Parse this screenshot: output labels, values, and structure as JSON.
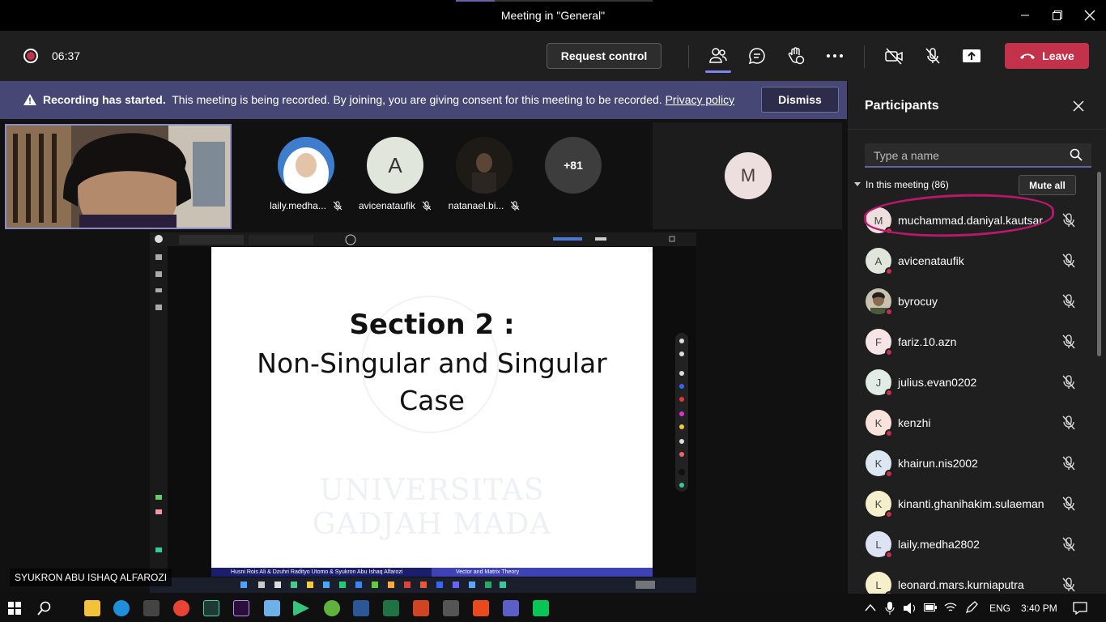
{
  "window": {
    "title": "Meeting in \"General\""
  },
  "toolbar": {
    "timer": "06:37",
    "request_control_label": "Request control",
    "leave_label": "Leave"
  },
  "banner": {
    "bold_text": "Recording has started.",
    "text": "This meeting is being recorded. By joining, you are giving consent for this meeting to be recorded.",
    "link_text": "Privacy policy",
    "dismiss_label": "Dismiss"
  },
  "stage": {
    "tiles": [
      {
        "name": "laily.medha...",
        "initial": ""
      },
      {
        "name": "avicenataufik",
        "initial": "A"
      },
      {
        "name": "natanael.bi...",
        "initial": ""
      }
    ],
    "overflow_count": "+81",
    "presenter_initial": "M",
    "presenter_label": "SYUKRON ABU ISHAQ ALFAROZI"
  },
  "slide": {
    "title": "Section 2 :",
    "subtitle_line1": "Non-Singular and Singular",
    "subtitle_line2": "Case",
    "watermark_line1": "UNIVERSITAS",
    "watermark_line2": "GADJAH MADA",
    "footer_left": "Husni Rois Ali & Dzuhri Radityo Utomo & Syukron Abu Ishaq Alfarozi",
    "footer_right": "Vector and Matrix Theory"
  },
  "panel": {
    "title": "Participants",
    "search_placeholder": "Type a name",
    "section_label": "In this meeting (86)",
    "mute_all_label": "Mute all",
    "participants": [
      {
        "name": "muchammad.daniyal.kautsar",
        "initial": "M",
        "color": "#eedfdf"
      },
      {
        "name": "avicenataufik",
        "initial": "A",
        "color": "#e0e6dc"
      },
      {
        "name": "byrocuy",
        "initial": "",
        "color": "#6b7a6a"
      },
      {
        "name": "fariz.10.azn",
        "initial": "F",
        "color": "#f6e4e6"
      },
      {
        "name": "julius.evan0202",
        "initial": "J",
        "color": "#e2ece6"
      },
      {
        "name": "kenzhi",
        "initial": "K",
        "color": "#f7e2dc"
      },
      {
        "name": "khairun.nis2002",
        "initial": "K",
        "color": "#dde7f2"
      },
      {
        "name": "kinanti.ghanihakim.sulaeman",
        "initial": "K",
        "color": "#f6efcc"
      },
      {
        "name": "laily.medha2802",
        "initial": "L",
        "color": "#dde3f2"
      },
      {
        "name": "leonard.mars.kurniaputra",
        "initial": "L",
        "color": "#f6efcc"
      }
    ]
  },
  "taskbar": {
    "language": "ENG",
    "time": "3:40 PM"
  }
}
